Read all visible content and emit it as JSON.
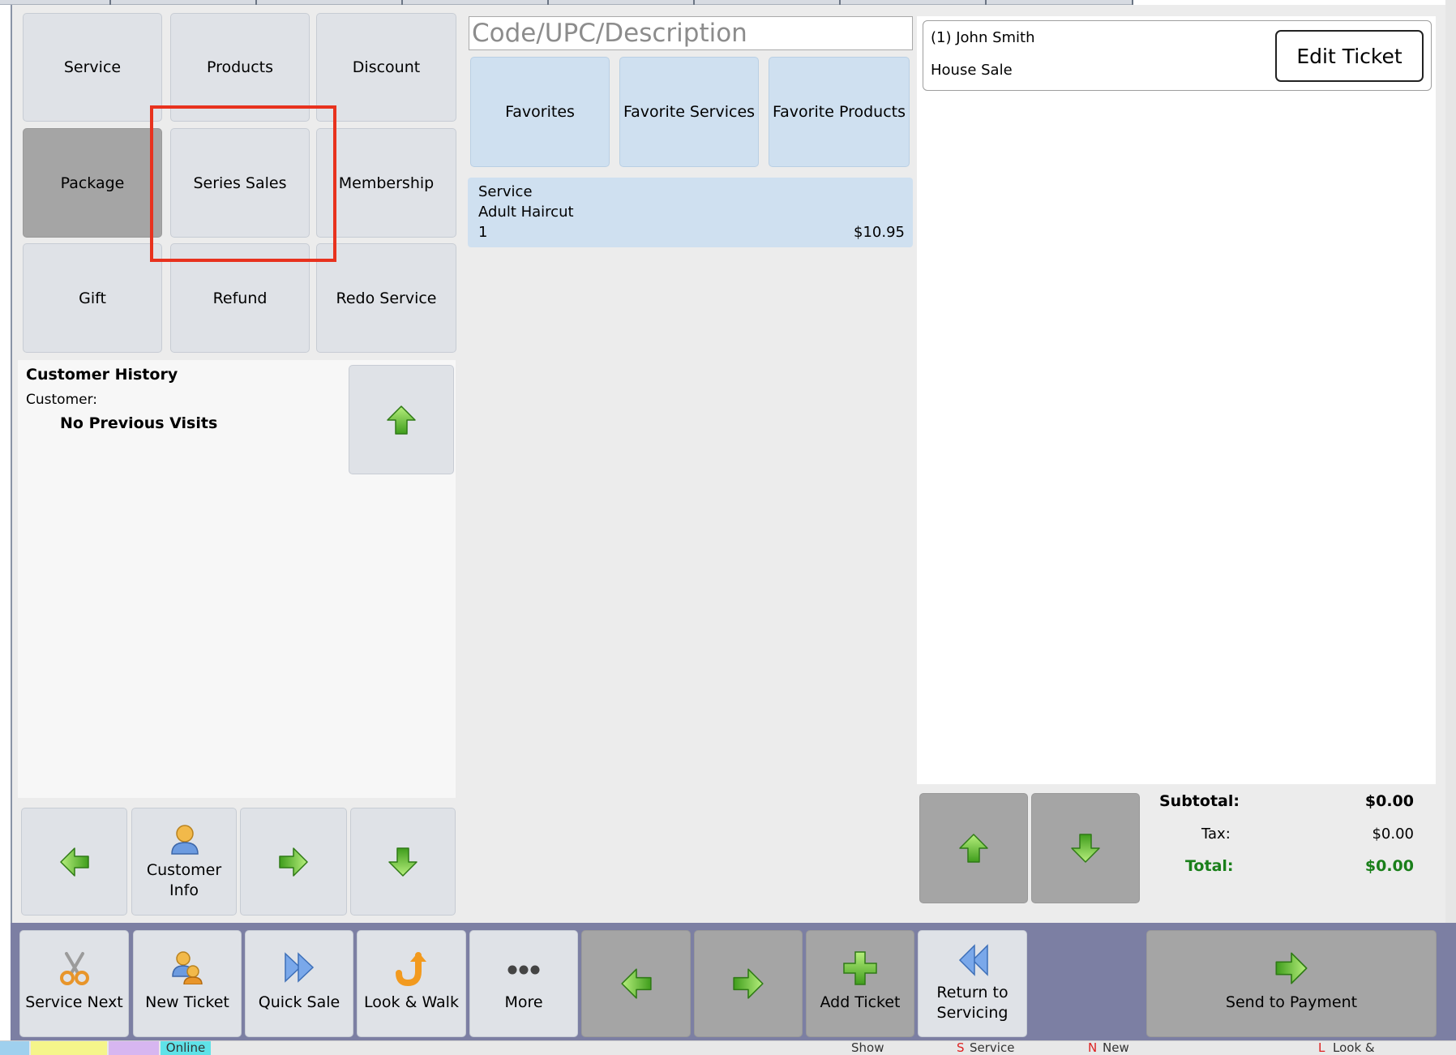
{
  "categories": {
    "service": "Service",
    "products": "Products",
    "discount": "Discount",
    "package": "Package",
    "series_sales": "Series Sales",
    "membership": "Membership",
    "gift": "Gift",
    "refund": "Refund",
    "redo_service": "Redo Service"
  },
  "search": {
    "placeholder": "Code/UPC/Description"
  },
  "favorites": {
    "favorites": "Favorites",
    "favorite_services": "Favorite Services",
    "favorite_products": "Favorite Products"
  },
  "line_item": {
    "type": "Service",
    "name": "Adult Haircut",
    "quantity": "1",
    "price": "$10.95"
  },
  "customer_history": {
    "title": "Customer History",
    "customer_label": "Customer:",
    "message": "No Previous Visits"
  },
  "customer_nav": {
    "customer_info_line1": "Customer",
    "customer_info_line2": "Info"
  },
  "ticket": {
    "customer": "(1) John Smith",
    "sale_type": "House Sale",
    "edit_label": "Edit Ticket"
  },
  "totals": {
    "subtotal_label": "Subtotal:",
    "subtotal": "$0.00",
    "tax_label": "Tax:",
    "tax": "$0.00",
    "total_label": "Total:",
    "total": "$0.00"
  },
  "toolbar": {
    "service_next": "Service Next",
    "new_ticket": "New Ticket",
    "quick_sale": "Quick Sale",
    "look_walk": "Look & Walk",
    "more": "More",
    "add_ticket": "Add Ticket",
    "return_line1": "Return to",
    "return_line2": "Servicing",
    "send_to_payment": "Send to Payment"
  },
  "status_strip": {
    "online": "Online",
    "show": "Show",
    "service_key": "S",
    "service": "Service",
    "new_key": "N",
    "new": "New",
    "look_key": "L",
    "look": "Look &"
  },
  "colors": {
    "arrow_green": "#5cbf2a",
    "tile": "#dfe2e7",
    "tile_dark": "#a5a5a5",
    "tile_blue": "#cfe0f0",
    "toolbar_bg": "#7c7fa3",
    "highlight": "#e8321e",
    "total_green": "#1a7f1a"
  }
}
